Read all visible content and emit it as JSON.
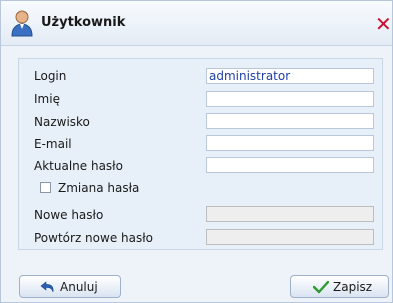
{
  "dialog": {
    "title": "Użytkownik",
    "title_icon": "user-icon",
    "close_icon": "close-icon",
    "close_symbol": "✕"
  },
  "form": {
    "login_label": "Login",
    "login_value": "administrator",
    "first_name_label": "Imię",
    "first_name_value": "",
    "last_name_label": "Nazwisko",
    "last_name_value": "",
    "email_label": "E-mail",
    "email_value": "",
    "current_password_label": "Aktualne hasło",
    "current_password_value": "",
    "change_password_label": "Zmiana hasła",
    "change_password_checked": false,
    "new_password_label": "Nowe hasło",
    "repeat_password_label": "Powtórz nowe hasło"
  },
  "buttons": {
    "cancel_label": "Anuluj",
    "cancel_icon": "undo-icon",
    "save_label": "Zapisz",
    "save_icon": "checkmark-icon"
  },
  "colors": {
    "close": "#c8102e",
    "save_check": "#2e9b2e",
    "cancel_arrow": "#2b5fb4",
    "field_text": "#1f3fa3"
  }
}
